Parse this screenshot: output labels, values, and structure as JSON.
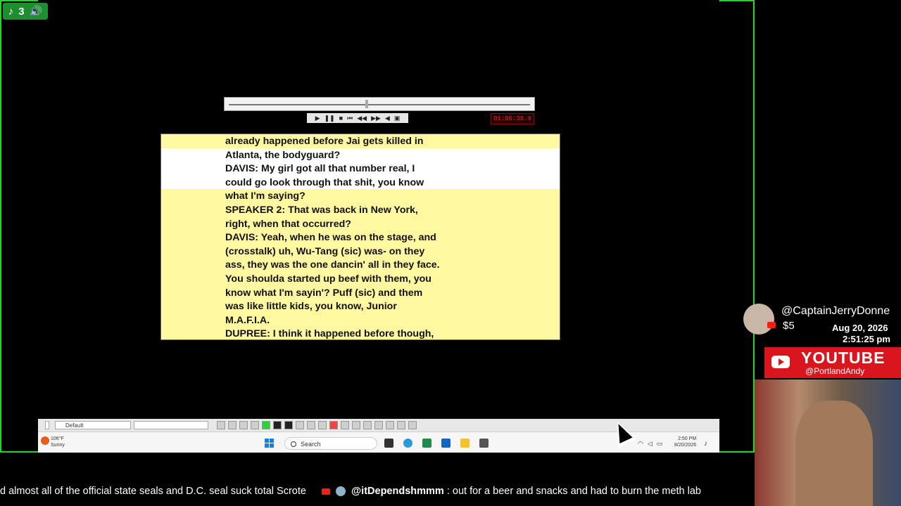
{
  "stream_badge": {
    "viewer_count": "3"
  },
  "player": {
    "timecode": "01:06:36.6"
  },
  "transcript": {
    "lines": [
      "already happened before Jai gets killed in",
      "Atlanta, the bodyguard?",
      "DAVIS: My girl got all that number real, I",
      "could go look through that shit, you know",
      "what I'm saying?",
      "SPEAKER 2: That was back in New York,",
      "right, when that occurred?",
      "DAVIS: Yeah, when he was on the stage, and",
      "(crosstalk) uh, Wu-Tang (sic) was- on they",
      "ass, they was the one dancin' all in they face.",
      "You shoulda started up beef with them, you",
      "know what I'm sayin'? Puff (sic) and them",
      "was like little kids, you know, Junior",
      "M.A.F.I.A.",
      "DUPREE: I think it happened before though,"
    ]
  },
  "taskbar": {
    "style_dropdown": "Default",
    "weather_temp": "106°F",
    "weather_desc": "Sunny",
    "search_placeholder": "Search",
    "clock_time": "2:50 PM",
    "clock_date": "8/20/2026"
  },
  "donation": {
    "username": "@CaptainJerryDonne",
    "amount": "$5",
    "date": "Aug 20, 2026",
    "time": "2:51:25 pm"
  },
  "youtube_banner": {
    "label": "YOUTUBE",
    "handle": "@PortlandAndy"
  },
  "ticker": {
    "lead_text": "d almost all of the official state seals and D.C. seal suck total Scrote",
    "user": "@itDependshmmm",
    "message": ": out for a beer and snacks and had to burn the meth lab"
  },
  "colors": {
    "frame_green": "#1fd62a",
    "transcript_yellow": "#fff8a0",
    "youtube_red": "#d9161e"
  }
}
